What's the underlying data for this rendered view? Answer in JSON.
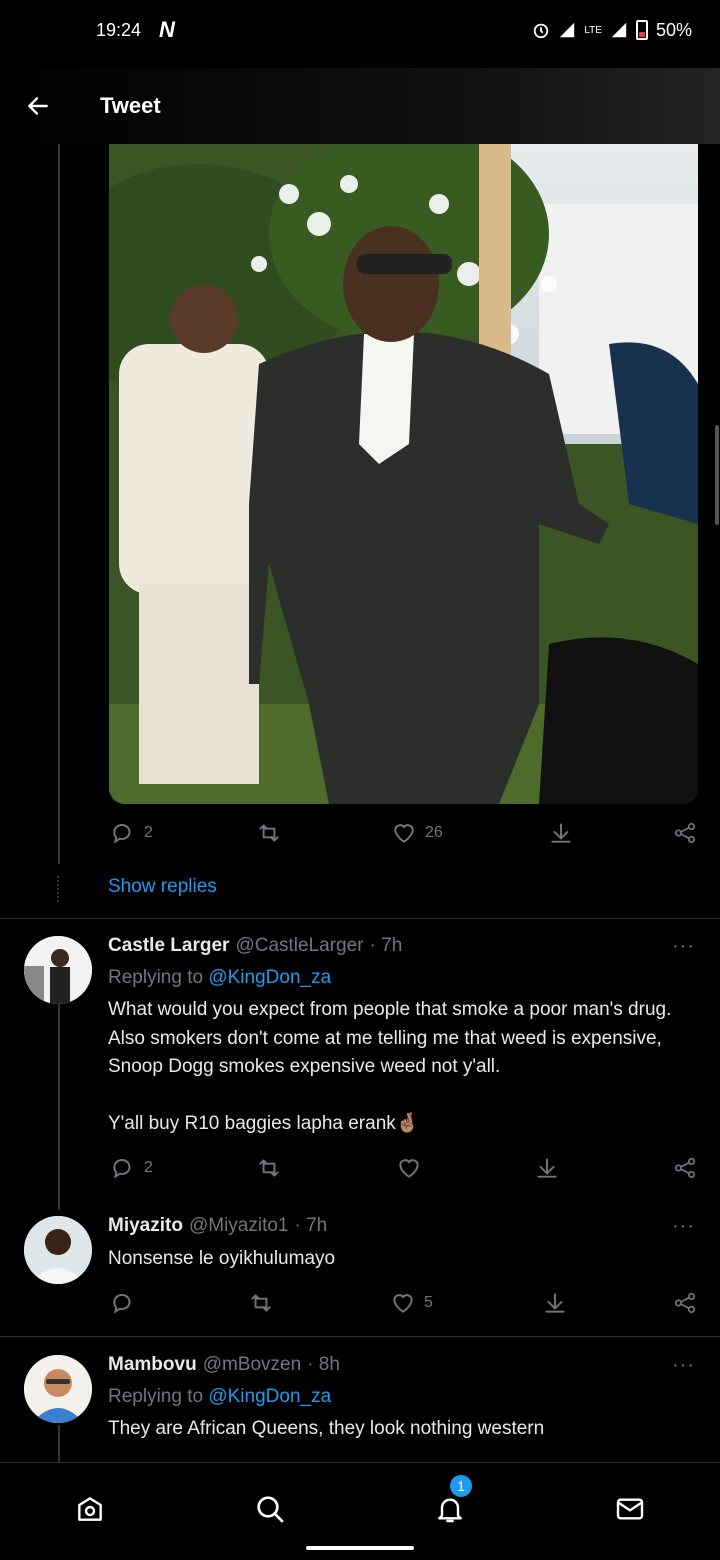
{
  "status_bar": {
    "time": "19:24",
    "network_label": "LTE",
    "battery_percent": "50%"
  },
  "header": {
    "title": "Tweet"
  },
  "main_tweet": {
    "reply_count": "2",
    "retweet_count": "",
    "like_count": "26",
    "show_replies_label": "Show replies"
  },
  "replies": [
    {
      "name": "Castle Larger",
      "handle": "@CastleLarger",
      "time": "· 7h",
      "replying_prefix": "Replying to",
      "replying_to": "@KingDon_za",
      "text_p1": "What would you expect from people that smoke a poor man's drug. Also smokers don't come at me telling me that weed is expensive, Snoop Dogg smokes expensive weed not y'all.",
      "text_p2": "Y'all buy R10 baggies lapha erank🤞🏽",
      "reply_count": "2",
      "like_count": ""
    },
    {
      "name": "Miyazito",
      "handle": "@Miyazito1",
      "time": "· 7h",
      "text_p1": "Nonsense le oyikhulumayo",
      "reply_count": "",
      "like_count": "5"
    },
    {
      "name": "Mambovu",
      "handle": "@mBovzen",
      "time": "· 8h",
      "replying_prefix": "Replying to",
      "replying_to": "@KingDon_za",
      "text_p1": "They are African Queens, they look nothing western"
    }
  ],
  "more_label": "···",
  "bottom_nav": {
    "notification_badge": "1"
  },
  "colors": {
    "background": "#000000",
    "accent": "#1d9bf0",
    "muted": "#71767b",
    "text": "#e7e9ea"
  },
  "icons": [
    "back-arrow-icon",
    "reply-icon",
    "retweet-icon",
    "like-icon",
    "share-icon",
    "more-icon",
    "home-icon",
    "search-icon",
    "bell-icon",
    "mail-icon"
  ]
}
